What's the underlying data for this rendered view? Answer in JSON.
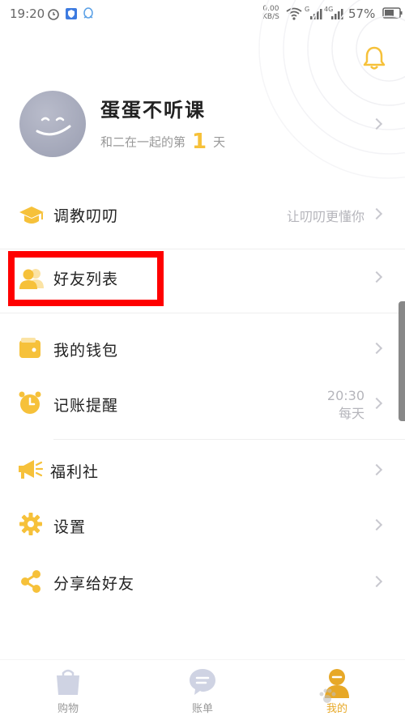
{
  "status_bar": {
    "time": "19:20",
    "net_speed_value": "0.00",
    "net_speed_unit": "KB/S",
    "signal1_label": "G",
    "signal2_label": "4G",
    "battery": "57%"
  },
  "profile": {
    "name": "蛋蛋不听课",
    "days_prefix": "和二在一起的第",
    "days_count": "1",
    "days_suffix": "天"
  },
  "menu": {
    "train": {
      "label": "调教叨叨",
      "hint": "让叨叨更懂你"
    },
    "friends": {
      "label": "好友列表"
    },
    "wallet": {
      "label": "我的钱包"
    },
    "reminder": {
      "label": "记账提醒",
      "time": "20:30",
      "frequency": "每天"
    },
    "welfare": {
      "label": "福利社"
    },
    "settings": {
      "label": "设置"
    },
    "share": {
      "label": "分享给好友"
    }
  },
  "tabs": [
    {
      "label": "购物"
    },
    {
      "label": "账单"
    },
    {
      "label": "我的"
    }
  ],
  "colors": {
    "accent": "#f6c13a",
    "highlight": "#ff0000",
    "active_tab": "#e7a827"
  }
}
